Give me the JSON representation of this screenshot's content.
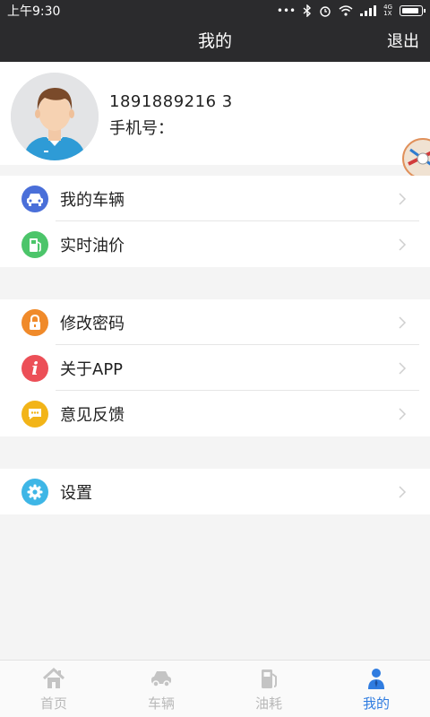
{
  "status_bar": {
    "time": "上午9:30",
    "signal_label_top": "4G",
    "signal_label_bottom": "1X"
  },
  "nav": {
    "title": "我的",
    "logout_label": "退出"
  },
  "profile": {
    "phone_number": "1891889216 3",
    "phone_label": "手机号："
  },
  "group1": [
    {
      "label": "我的车辆",
      "icon": "car-icon",
      "color": "#4a6fd9"
    },
    {
      "label": "实时油价",
      "icon": "fuel-pump-icon",
      "color": "#4cc56a"
    }
  ],
  "group2": [
    {
      "label": "修改密码",
      "icon": "lock-icon",
      "color": "#f08a2a"
    },
    {
      "label": "关于APP",
      "icon": "info-icon",
      "color": "#ec4f57"
    },
    {
      "label": "意见反馈",
      "icon": "feedback-icon",
      "color": "#f2b418"
    }
  ],
  "group3": [
    {
      "label": "设置",
      "icon": "gear-icon",
      "color": "#3eb6e6"
    }
  ],
  "tabs": [
    {
      "label": "首页",
      "icon": "home-icon",
      "active": false
    },
    {
      "label": "车辆",
      "icon": "car-tab-icon",
      "active": false
    },
    {
      "label": "油耗",
      "icon": "fuel-tab-icon",
      "active": false
    },
    {
      "label": "我的",
      "icon": "person-icon",
      "active": true
    }
  ],
  "colors": {
    "header_bg": "#2b2b2d",
    "tab_active": "#2f7ce0",
    "tab_inactive": "#b9b9b9",
    "page_bg": "#f4f4f4"
  }
}
